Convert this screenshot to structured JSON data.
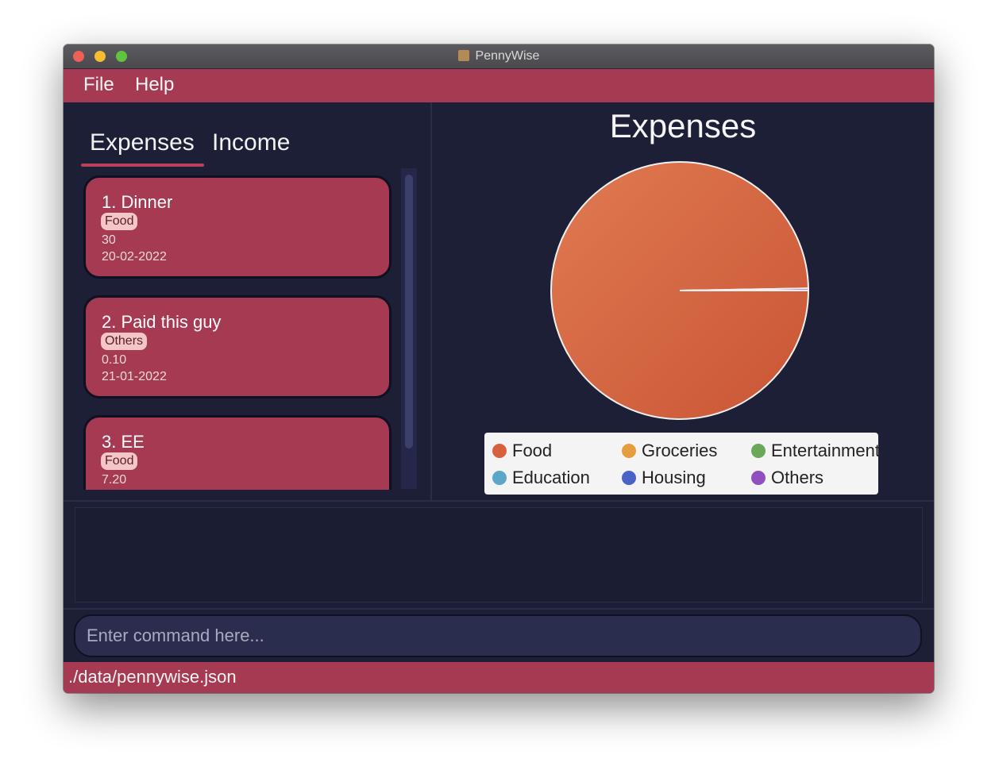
{
  "window": {
    "title": "PennyWise"
  },
  "menubar": {
    "items": [
      {
        "label": "File"
      },
      {
        "label": "Help"
      }
    ]
  },
  "tabs": [
    {
      "label": "Expenses",
      "selected": true
    },
    {
      "label": "Income",
      "selected": false
    }
  ],
  "entries": [
    {
      "title": "1.  Dinner",
      "category": "Food",
      "amount": "30",
      "date": "20-02-2022"
    },
    {
      "title": "2.  Paid this guy",
      "category": "Others",
      "amount": "0.10",
      "date": "21-01-2022"
    },
    {
      "title": "3.  EE",
      "category": "Food",
      "amount": "7.20",
      "date": ""
    }
  ],
  "chart_data": {
    "type": "pie",
    "title": "Expenses",
    "slices": [
      {
        "label": "Food",
        "value": 37.2,
        "color": "#d9603f"
      },
      {
        "label": "Groceries",
        "value": 0,
        "color": "#e59d3f"
      },
      {
        "label": "Entertainment",
        "value": 0,
        "color": "#6aa85a"
      },
      {
        "label": "Education",
        "value": 0,
        "color": "#5aa7c9"
      },
      {
        "label": "Housing",
        "value": 0,
        "color": "#4a63c9"
      },
      {
        "label": "Others",
        "value": 0.1,
        "color": "#9150c0"
      }
    ],
    "legend_position": "bottom"
  },
  "command": {
    "placeholder": "Enter command here..."
  },
  "status": {
    "path": "./data/pennywise.json"
  },
  "colors": {
    "accent": "#a53a52",
    "background": "#1d1f36"
  }
}
